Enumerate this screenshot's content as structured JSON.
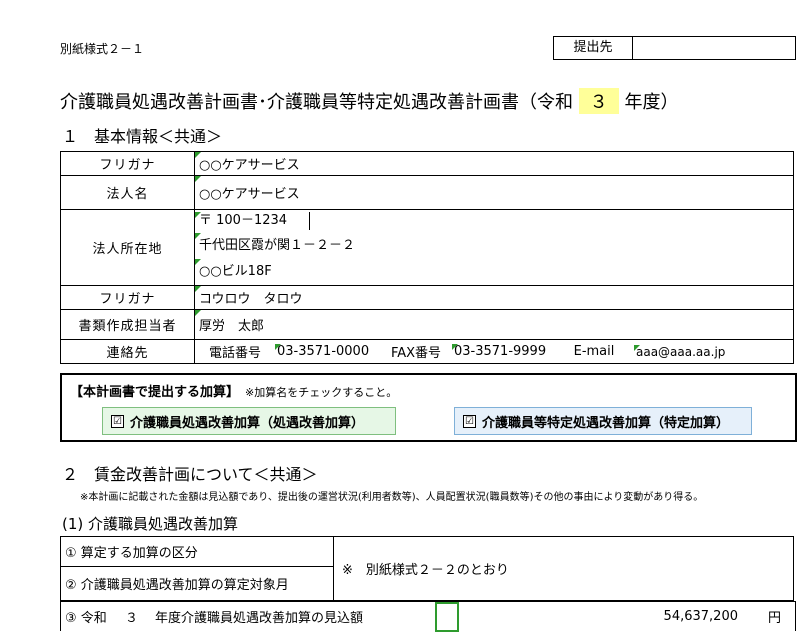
{
  "form_tag": "別紙様式２－１",
  "submit": {
    "label": "提出先",
    "value": ""
  },
  "title": {
    "prefix": "介護職員処遇改善計画書･介護職員等特定処遇改善計画書（令和",
    "year": "３",
    "suffix": "年度）"
  },
  "section1": "１　基本情報＜共通＞",
  "info": {
    "furigana1_label": "フリガナ",
    "furigana1": "○○ケアサービス",
    "corp_label": "法人名",
    "corp": "○○ケアサービス",
    "address_label": "法人所在地",
    "zip": "〒 100－1234",
    "addr1": "千代田区霞が関１－２－２",
    "addr2": "○○ビル18F",
    "furigana2_label": "フリガナ",
    "furigana2": "コウロウ　タロウ",
    "author_label": "書類作成担当者",
    "author": "厚労　太郎",
    "contact_label": "連絡先",
    "tel_label": "電話番号",
    "tel": "03-3571-0000",
    "fax_label": "FAX番号",
    "fax": "03-3571-9999",
    "email_label": "E-mail",
    "email": "aaa@aaa.aa.jp"
  },
  "addition": {
    "header": "【本計画書で提出する加算】",
    "note": "※加算名をチェックすること。",
    "opt1": "介護職員処遇改善加算（処遇改善加算）",
    "opt2": "介護職員等特定処遇改善加算（特定加算）",
    "check": "☑"
  },
  "section2": "２　賃金改善計画について＜共通＞",
  "section2_note": "※本計画に記載された金額は見込額であり、提出後の運営状況(利用者数等)、人員配置状況(職員数等)その他の事由により変動があり得る。",
  "sub1": "(1) 介護職員処遇改善加算",
  "rows": {
    "r1": "① 算定する加算の区分",
    "r2": "② 介護職員処遇改善加算の算定対象月",
    "ref": "※　別紙様式２－２のとおり",
    "r3_prefix": "③ 令和",
    "r3_year": "３",
    "r3_suffix": "年度介護職員処遇改善加算の見込額",
    "r3_amount": "54,637,200",
    "r3_unit": "円"
  }
}
